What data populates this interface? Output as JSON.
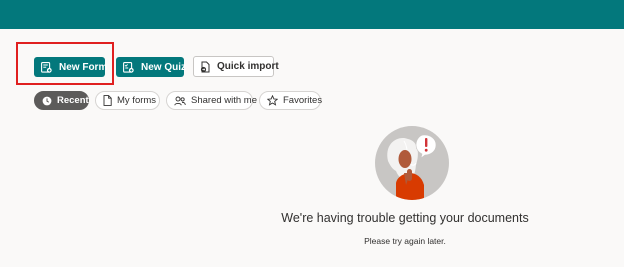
{
  "colors": {
    "topbar": "#03787c",
    "primary_button": "#03787c",
    "active_pill": "#5c5b5a",
    "highlight_box": "#e02020",
    "page_background": "#faf9f8"
  },
  "toolbar": {
    "new_form_label": "New Form",
    "new_form_icon": "form-add-icon",
    "new_quiz_label": "New Quiz",
    "new_quiz_icon": "quiz-add-icon",
    "quick_import_label": "Quick import",
    "quick_import_icon": "document-import-icon"
  },
  "filters": [
    {
      "label": "Recent",
      "icon": "clock-icon",
      "selected": true
    },
    {
      "label": "My forms",
      "icon": "document-icon",
      "selected": false
    },
    {
      "label": "Shared with me",
      "icon": "people-icon",
      "selected": false
    },
    {
      "label": "Favorites",
      "icon": "star-icon",
      "selected": false
    }
  ],
  "empty_state": {
    "illustration": "thinking-person-alert-illustration",
    "title": "We're having trouble getting your documents",
    "subtitle": "Please try again later."
  }
}
